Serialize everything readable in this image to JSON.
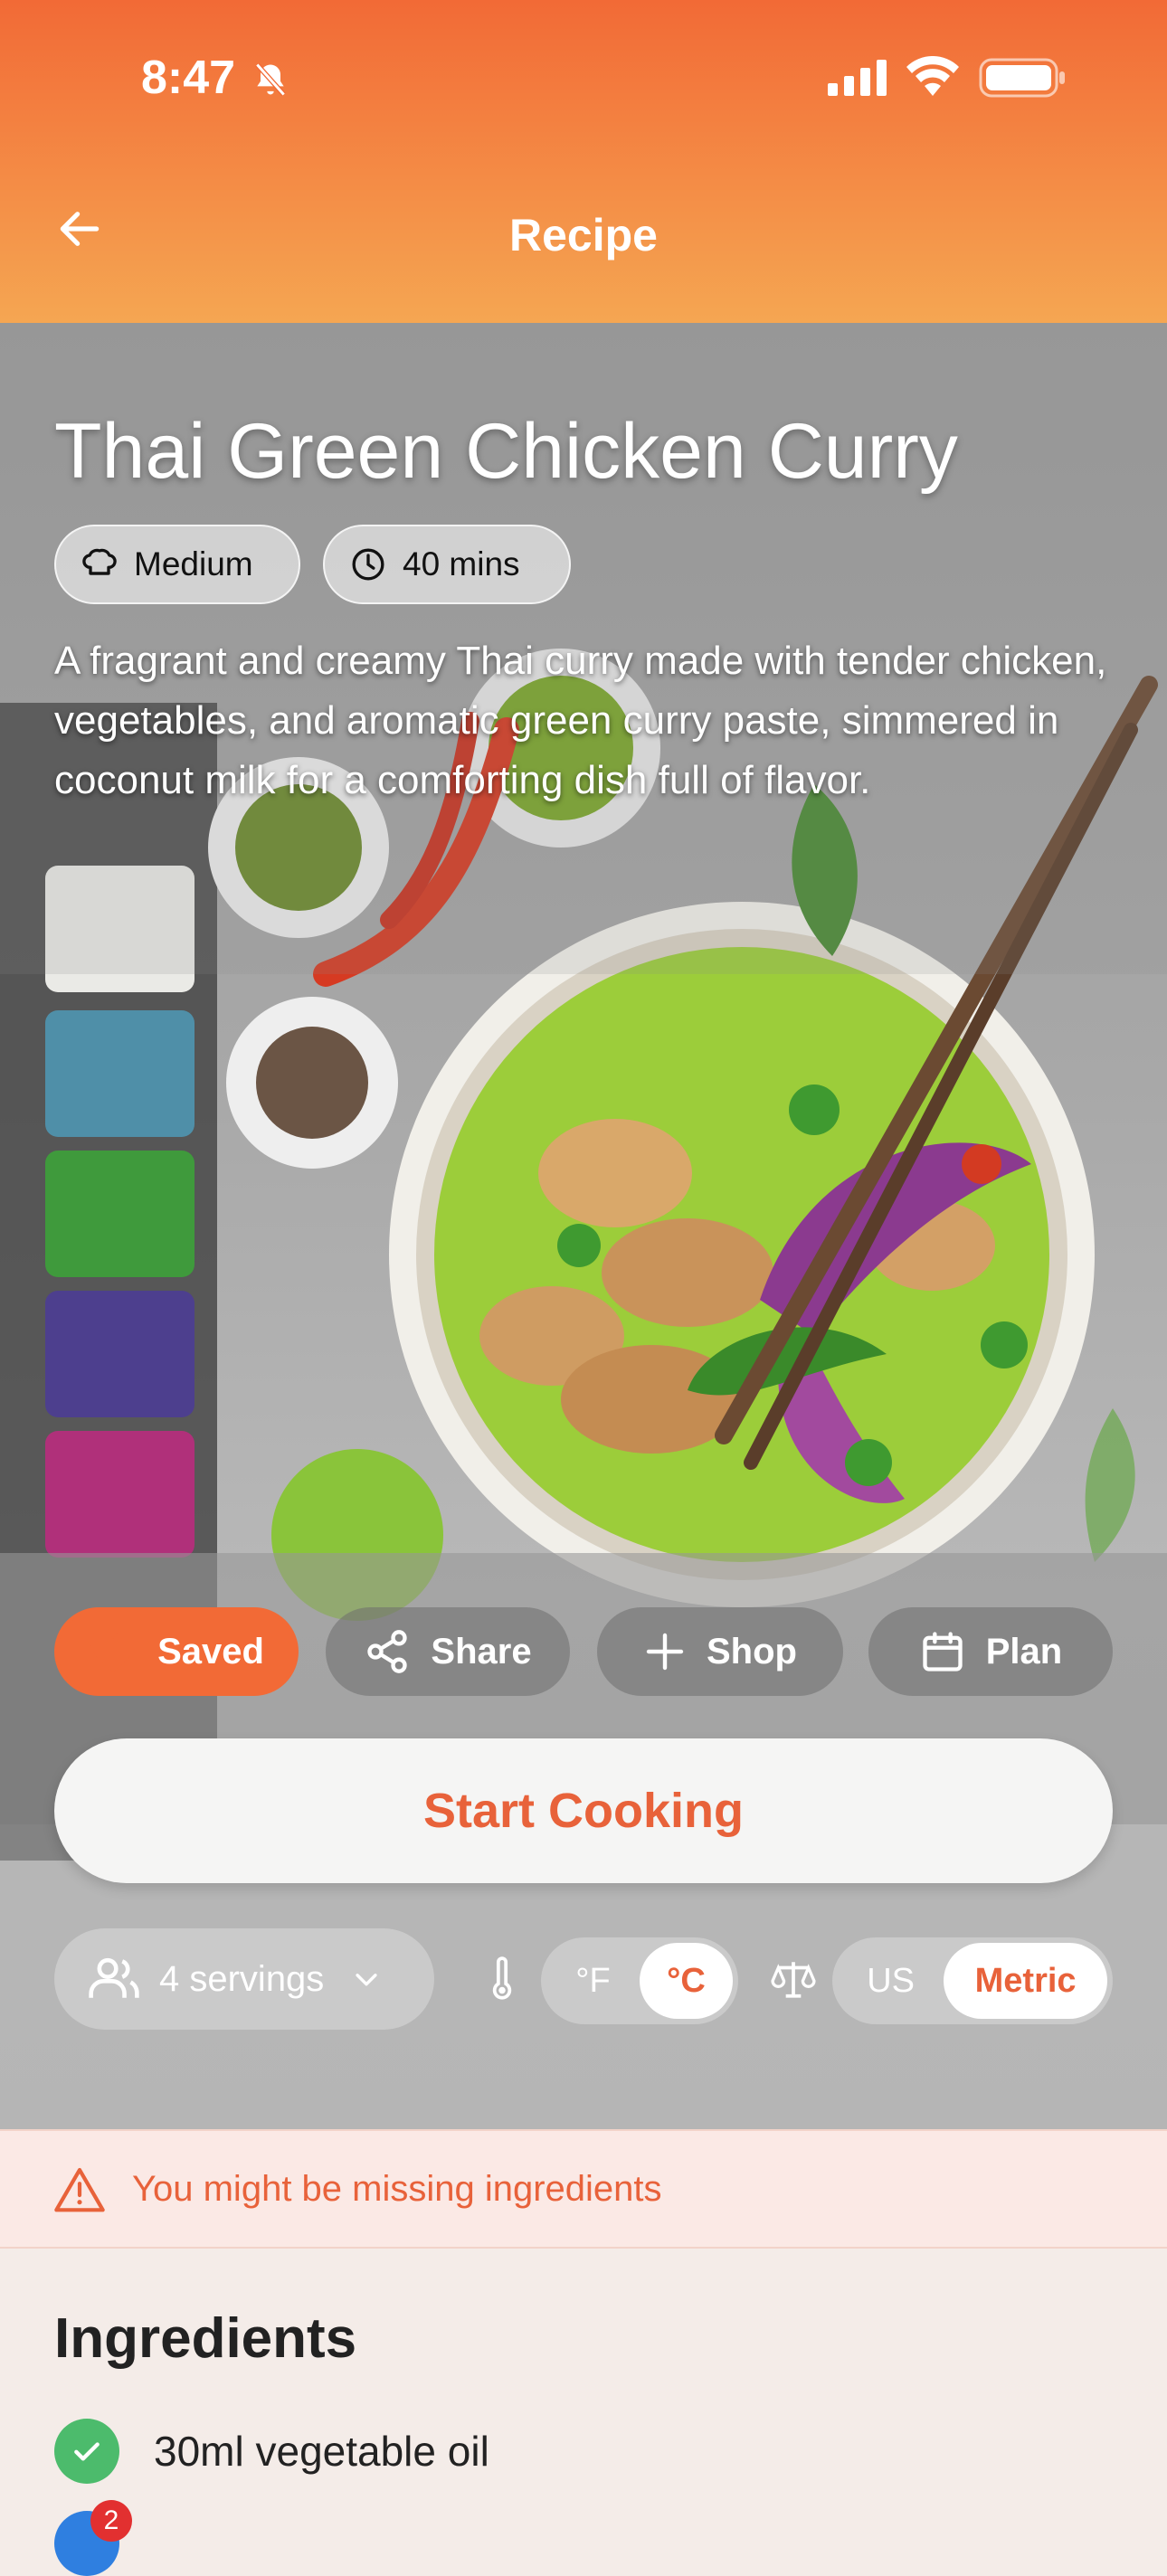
{
  "status_bar": {
    "time": "8:47"
  },
  "header": {
    "title": "Recipe"
  },
  "recipe": {
    "title": "Thai Green Chicken Curry",
    "difficulty": "Medium",
    "time": "40 mins",
    "description": "A fragrant and creamy Thai curry made with tender chicken, vegetables, and aromatic green curry paste, simmered in coconut milk for a comforting dish full of flavor."
  },
  "actions": {
    "saved_label": "Saved",
    "share_label": "Share",
    "shop_label": "Shop",
    "plan_label": "Plan"
  },
  "start_cooking_label": "Start Cooking",
  "settings": {
    "servings_label": "4 servings",
    "temp_f": "°F",
    "temp_c": "°C",
    "temp_selected": "°C",
    "unit_us": "US",
    "unit_metric": "Metric",
    "unit_selected": "Metric"
  },
  "warning": {
    "text": "You might be missing ingredients"
  },
  "ingredients": {
    "title": "Ingredients",
    "items": [
      {
        "text": "30ml vegetable oil",
        "status": "available"
      }
    ],
    "next_item_badge": "2"
  },
  "colors": {
    "accent": "#e8623a",
    "header_top": "#f26a36",
    "header_bottom": "#f5a652",
    "check_green": "#4cbb6c"
  }
}
